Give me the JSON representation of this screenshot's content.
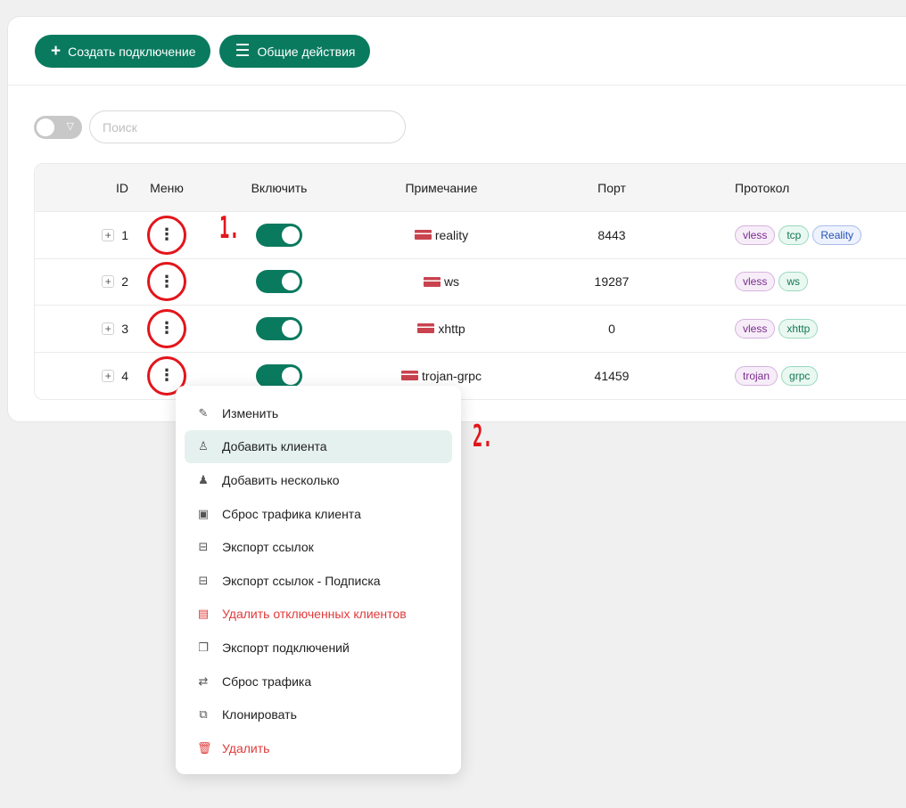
{
  "toolbar": {
    "create_label": "Создать подключение",
    "create_icon": "plus-icon",
    "actions_label": "Общие действия",
    "actions_icon": "menu-lines-icon"
  },
  "search": {
    "placeholder": "Поиск"
  },
  "table": {
    "headers": {
      "id": "ID",
      "menu": "Меню",
      "enable": "Включить",
      "note": "Примечание",
      "port": "Порт",
      "protocol": "Протокол"
    },
    "rows": [
      {
        "id": "1",
        "note": "reality",
        "port": "8443",
        "enabled": true,
        "tags": [
          {
            "text": "vless",
            "color": "purple"
          },
          {
            "text": "tcp",
            "color": "green"
          },
          {
            "text": "Reality",
            "color": "blue"
          }
        ]
      },
      {
        "id": "2",
        "note": "ws",
        "port": "19287",
        "enabled": true,
        "tags": [
          {
            "text": "vless",
            "color": "purple"
          },
          {
            "text": "ws",
            "color": "green"
          }
        ]
      },
      {
        "id": "3",
        "note": "xhttp",
        "port": "0",
        "enabled": true,
        "tags": [
          {
            "text": "vless",
            "color": "purple"
          },
          {
            "text": "xhttp",
            "color": "green"
          }
        ]
      },
      {
        "id": "4",
        "note": "trojan-grpc",
        "port": "41459",
        "enabled": true,
        "tags": [
          {
            "text": "trojan",
            "color": "purple"
          },
          {
            "text": "grpc",
            "color": "green"
          }
        ]
      }
    ]
  },
  "annotations": {
    "one": "1.",
    "two": "2."
  },
  "context_menu": {
    "items": [
      {
        "label": "Изменить",
        "icon": "edit-icon",
        "glyph": "✎",
        "danger": false
      },
      {
        "label": "Добавить клиента",
        "icon": "user-add-icon",
        "glyph": "♙",
        "danger": false,
        "active": true
      },
      {
        "label": "Добавить несколько",
        "icon": "users-add-icon",
        "glyph": "♟",
        "danger": false
      },
      {
        "label": "Сброс трафика клиента",
        "icon": "reset-client-icon",
        "glyph": "▣",
        "danger": false
      },
      {
        "label": "Экспорт ссылок",
        "icon": "export-icon",
        "glyph": "⊟",
        "danger": false
      },
      {
        "label": "Экспорт ссылок - Подписка",
        "icon": "export-sub-icon",
        "glyph": "⊟",
        "danger": false
      },
      {
        "label": "Удалить отключенных клиентов",
        "icon": "delete-disabled-icon",
        "glyph": "▤",
        "danger": true
      },
      {
        "label": "Экспорт подключений",
        "icon": "copy-icon",
        "glyph": "❐",
        "danger": false
      },
      {
        "label": "Сброс трафика",
        "icon": "swap-icon",
        "glyph": "⇄",
        "danger": false
      },
      {
        "label": "Клонировать",
        "icon": "clone-icon",
        "glyph": "⧉",
        "danger": false
      },
      {
        "label": "Удалить",
        "icon": "trash-icon",
        "glyph": "🗑",
        "danger": true
      }
    ]
  },
  "colors": {
    "primary": "#0a7a5f",
    "danger": "#e03a3a",
    "annotation": "#e3151b"
  }
}
